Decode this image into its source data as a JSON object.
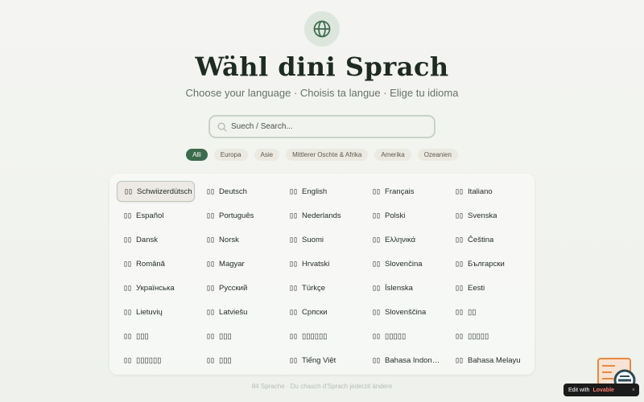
{
  "header": {
    "title": "Wähl dini Sprach",
    "subtitle": "Choose your language · Choisis ta langue · Elige tu idioma"
  },
  "search": {
    "placeholder": "Suech / Search..."
  },
  "filters": [
    {
      "label": "Alli",
      "active": true
    },
    {
      "label": "Europa",
      "active": false
    },
    {
      "label": "Asie",
      "active": false
    },
    {
      "label": "Mittlerer Oschte & Afrika",
      "active": false
    },
    {
      "label": "Amerika",
      "active": false
    },
    {
      "label": "Ozeanien",
      "active": false
    }
  ],
  "languages": [
    {
      "flag": "▯▯",
      "name": "Schwiizerdütsch",
      "selected": true
    },
    {
      "flag": "▯▯",
      "name": "Deutsch"
    },
    {
      "flag": "▯▯",
      "name": "English"
    },
    {
      "flag": "▯▯",
      "name": "Français"
    },
    {
      "flag": "▯▯",
      "name": "Italiano"
    },
    {
      "flag": "▯▯",
      "name": "Español"
    },
    {
      "flag": "▯▯",
      "name": "Português"
    },
    {
      "flag": "▯▯",
      "name": "Nederlands"
    },
    {
      "flag": "▯▯",
      "name": "Polski"
    },
    {
      "flag": "▯▯",
      "name": "Svenska"
    },
    {
      "flag": "▯▯",
      "name": "Dansk"
    },
    {
      "flag": "▯▯",
      "name": "Norsk"
    },
    {
      "flag": "▯▯",
      "name": "Suomi"
    },
    {
      "flag": "▯▯",
      "name": "Ελληνικά"
    },
    {
      "flag": "▯▯",
      "name": "Čeština"
    },
    {
      "flag": "▯▯",
      "name": "Română"
    },
    {
      "flag": "▯▯",
      "name": "Magyar"
    },
    {
      "flag": "▯▯",
      "name": "Hrvatski"
    },
    {
      "flag": "▯▯",
      "name": "Slovenčina"
    },
    {
      "flag": "▯▯",
      "name": "Български"
    },
    {
      "flag": "▯▯",
      "name": "Українська"
    },
    {
      "flag": "▯▯",
      "name": "Русский"
    },
    {
      "flag": "▯▯",
      "name": "Türkçe"
    },
    {
      "flag": "▯▯",
      "name": "Íslenska"
    },
    {
      "flag": "▯▯",
      "name": "Eesti"
    },
    {
      "flag": "▯▯",
      "name": "Lietuvių"
    },
    {
      "flag": "▯▯",
      "name": "Latviešu"
    },
    {
      "flag": "▯▯",
      "name": "Српски"
    },
    {
      "flag": "▯▯",
      "name": "Slovenščina"
    },
    {
      "flag": "▯▯",
      "name": "▯▯"
    },
    {
      "flag": "▯▯",
      "name": "▯▯▯"
    },
    {
      "flag": "▯▯",
      "name": "▯▯▯"
    },
    {
      "flag": "▯▯",
      "name": "▯▯▯▯▯▯"
    },
    {
      "flag": "▯▯",
      "name": "▯▯▯▯▯"
    },
    {
      "flag": "▯▯",
      "name": "▯▯▯▯▯"
    },
    {
      "flag": "▯▯",
      "name": "▯▯▯▯▯▯"
    },
    {
      "flag": "▯▯",
      "name": "▯▯▯"
    },
    {
      "flag": "▯▯",
      "name": "Tiếng Việt"
    },
    {
      "flag": "▯▯",
      "name": "Bahasa Indonesia"
    },
    {
      "flag": "▯▯",
      "name": "Bahasa Melayu"
    }
  ],
  "footer": {
    "text": "84 Sprache · Du chasch d'Sprach jederzit ändere"
  },
  "lovable_badge": {
    "prefix": "Edit with",
    "brand": "Lovable",
    "close": "×"
  },
  "colors": {
    "accent": "#3b6b4c",
    "chip_bg": "#ece9e1"
  },
  "icons": {
    "header": "globe-icon",
    "search": "search-icon"
  }
}
